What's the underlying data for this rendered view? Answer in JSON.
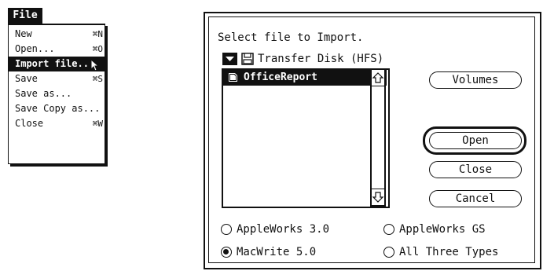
{
  "menu": {
    "title": "File",
    "items": [
      {
        "label": "New",
        "shortcut": "⌘N",
        "selected": false
      },
      {
        "label": "Open...",
        "shortcut": "⌘O",
        "selected": false
      },
      {
        "label": "Import file...",
        "shortcut": "",
        "selected": true
      },
      {
        "label": "Save",
        "shortcut": "⌘S",
        "selected": false
      },
      {
        "label": "Save as...",
        "shortcut": "",
        "selected": false
      },
      {
        "label": "Save Copy as...",
        "shortcut": "",
        "selected": false
      },
      {
        "label": "Close",
        "shortcut": "⌘W",
        "selected": false
      }
    ]
  },
  "dialog": {
    "prompt": "Select file to Import.",
    "disk_name": "Transfer Disk (HFS)",
    "files": [
      {
        "name": "OfficeReport",
        "selected": true
      }
    ],
    "buttons": {
      "volumes": "Volumes",
      "open": "Open",
      "close": "Close",
      "cancel": "Cancel"
    },
    "file_types": [
      {
        "label": "AppleWorks 3.0",
        "selected": false
      },
      {
        "label": "AppleWorks GS",
        "selected": false
      },
      {
        "label": "MacWrite 5.0",
        "selected": true
      },
      {
        "label": "All Three Types",
        "selected": false
      }
    ]
  }
}
